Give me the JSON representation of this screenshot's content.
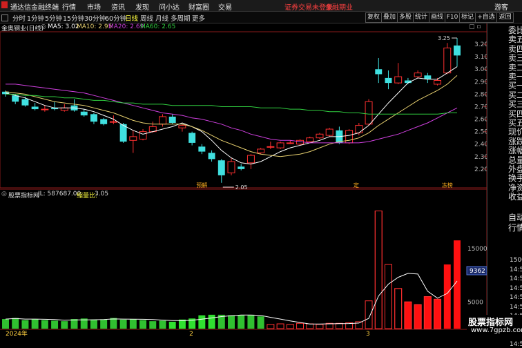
{
  "titlebar": {
    "app_name": "通达信金融终端",
    "menu": [
      "行情",
      "市场",
      "资讯",
      "发现",
      "问小达",
      "财富圈",
      "交易"
    ],
    "notice1": "证券交易未登录",
    "notice2": "金融期业",
    "guest": "游客"
  },
  "toolbar": {
    "periods": [
      "分时",
      "1分钟",
      "5分钟",
      "15分钟",
      "30分钟",
      "60分钟",
      "日线",
      "周线",
      "月线",
      "多周期",
      "更多"
    ],
    "active": "日线",
    "right_buttons": [
      "复权",
      "叠加",
      "多股",
      "统计",
      "画线",
      "F10",
      "标记",
      "+自选",
      "返回"
    ]
  },
  "stock": {
    "name": "金奥钢业(日线)"
  },
  "ma_legend": [
    {
      "label": "MA5: 3.02",
      "color": "#ffffff"
    },
    {
      "label": "MA10: 2.95",
      "color": "#e8d170"
    },
    {
      "label": "MA20: 2.69",
      "color": "#d040e0"
    },
    {
      "label": "MA60: 2.65",
      "color": "#30d040"
    }
  ],
  "indicator_legend": {
    "name": "股票指标网",
    "jl": "JL: 587687.00",
    "ratio_label": "缩量比:",
    "ratio_value": "3.05"
  },
  "price_axis": [
    "3.20",
    "3.10",
    "3.00",
    "2.90",
    "2.80",
    "2.70",
    "2.60",
    "2.50",
    "2.40",
    "2.30",
    "2.20"
  ],
  "annotations": {
    "high": "3.25",
    "low": "2.05"
  },
  "event_markers": [
    "预解",
    "定",
    "冻榜"
  ],
  "time_axis": [
    "2024年",
    "2",
    "3"
  ],
  "right_panel": [
    "委比",
    "卖五",
    "卖四",
    "卖三",
    "卖二",
    "卖一",
    "买一",
    "买二",
    "买三",
    "买四",
    "买五",
    "现价",
    "涨跌",
    "涨幅",
    "总量",
    "外盘",
    "换手",
    "净资",
    "收益"
  ],
  "vol_panel": {
    "labels": [
      "自动",
      "行情"
    ],
    "ticks": [
      "15000",
      "14:50",
      "14:50",
      "14:50",
      "14:50",
      "14:50",
      "14:50",
      "5000",
      "14:50",
      "14:50"
    ],
    "box_value": "9362"
  },
  "watermark": {
    "line1": "股票指标网",
    "line2": "www.7gpzb.com"
  },
  "colors": {
    "up": "#ff3030",
    "down": "#40e0e0",
    "vol_down": "#30e030",
    "vol_up_last": "#ff1010"
  },
  "chart_data": {
    "type": "candlestick",
    "candles": [
      {
        "o": 2.82,
        "c": 2.8,
        "h": 2.83,
        "l": 2.78
      },
      {
        "o": 2.79,
        "c": 2.74,
        "h": 2.8,
        "l": 2.72
      },
      {
        "o": 2.76,
        "c": 2.71,
        "h": 2.78,
        "l": 2.7
      },
      {
        "o": 2.7,
        "c": 2.68,
        "h": 2.73,
        "l": 2.67
      },
      {
        "o": 2.68,
        "c": 2.68,
        "h": 2.71,
        "l": 2.66
      },
      {
        "o": 2.69,
        "c": 2.68,
        "h": 2.74,
        "l": 2.67
      },
      {
        "o": 2.67,
        "c": 2.69,
        "h": 2.72,
        "l": 2.66
      },
      {
        "o": 2.71,
        "c": 2.67,
        "h": 2.76,
        "l": 2.66
      },
      {
        "o": 2.66,
        "c": 2.63,
        "h": 2.68,
        "l": 2.62
      },
      {
        "o": 2.64,
        "c": 2.58,
        "h": 2.65,
        "l": 2.56
      },
      {
        "o": 2.6,
        "c": 2.56,
        "h": 2.61,
        "l": 2.55
      },
      {
        "o": 2.58,
        "c": 2.58,
        "h": 2.63,
        "l": 2.56
      },
      {
        "o": 2.56,
        "c": 2.42,
        "h": 2.57,
        "l": 2.41
      },
      {
        "o": 2.43,
        "c": 2.46,
        "h": 2.51,
        "l": 2.33
      },
      {
        "o": 2.44,
        "c": 2.5,
        "h": 2.52,
        "l": 2.43
      },
      {
        "o": 2.5,
        "c": 2.54,
        "h": 2.58,
        "l": 2.49
      },
      {
        "o": 2.56,
        "c": 2.62,
        "h": 2.64,
        "l": 2.54
      },
      {
        "o": 2.62,
        "c": 2.57,
        "h": 2.64,
        "l": 2.56
      },
      {
        "o": 2.53,
        "c": 2.55,
        "h": 2.56,
        "l": 2.5
      },
      {
        "o": 2.49,
        "c": 2.41,
        "h": 2.5,
        "l": 2.39
      },
      {
        "o": 2.38,
        "c": 2.34,
        "h": 2.4,
        "l": 2.32
      },
      {
        "o": 2.33,
        "c": 2.28,
        "h": 2.35,
        "l": 2.26
      },
      {
        "o": 2.27,
        "c": 2.15,
        "h": 2.28,
        "l": 2.09
      },
      {
        "o": 2.17,
        "c": 2.26,
        "h": 2.29,
        "l": 2.15
      },
      {
        "o": 2.22,
        "c": 2.2,
        "h": 2.24,
        "l": 2.19
      },
      {
        "o": 2.25,
        "c": 2.31,
        "h": 2.32,
        "l": 2.2
      },
      {
        "o": 2.33,
        "c": 2.36,
        "h": 2.37,
        "l": 2.32
      },
      {
        "o": 2.38,
        "c": 2.38,
        "h": 2.42,
        "l": 2.36
      },
      {
        "o": 2.37,
        "c": 2.41,
        "h": 2.42,
        "l": 2.36
      },
      {
        "o": 2.41,
        "c": 2.41,
        "h": 2.43,
        "l": 2.4
      },
      {
        "o": 2.4,
        "c": 2.43,
        "h": 2.44,
        "l": 2.39
      },
      {
        "o": 2.42,
        "c": 2.45,
        "h": 2.46,
        "l": 2.41
      },
      {
        "o": 2.45,
        "c": 2.48,
        "h": 2.49,
        "l": 2.44
      },
      {
        "o": 2.47,
        "c": 2.52,
        "h": 2.53,
        "l": 2.46
      },
      {
        "o": 2.51,
        "c": 2.41,
        "h": 2.54,
        "l": 2.4
      },
      {
        "o": 2.41,
        "c": 2.51,
        "h": 2.52,
        "l": 2.4
      },
      {
        "o": 2.49,
        "c": 2.55,
        "h": 2.57,
        "l": 2.47
      },
      {
        "o": 2.56,
        "c": 2.74,
        "h": 2.76,
        "l": 2.55
      },
      {
        "o": 3.0,
        "c": 2.96,
        "h": 3.09,
        "l": 2.89
      },
      {
        "o": 2.93,
        "c": 2.89,
        "h": 2.99,
        "l": 2.84
      },
      {
        "o": 2.89,
        "c": 2.94,
        "h": 3.05,
        "l": 2.88
      },
      {
        "o": 2.91,
        "c": 2.89,
        "h": 2.93,
        "l": 2.88
      },
      {
        "o": 2.94,
        "c": 2.97,
        "h": 2.99,
        "l": 2.93
      },
      {
        "o": 2.95,
        "c": 2.92,
        "h": 2.97,
        "l": 2.89
      },
      {
        "o": 2.88,
        "c": 2.91,
        "h": 2.93,
        "l": 2.87
      },
      {
        "o": 2.97,
        "c": 3.17,
        "h": 3.21,
        "l": 2.96
      },
      {
        "o": 3.19,
        "c": 3.11,
        "h": 3.25,
        "l": 3.02
      }
    ],
    "ma5": [
      2.81,
      2.79,
      2.77,
      2.74,
      2.71,
      2.69,
      2.69,
      2.69,
      2.68,
      2.66,
      2.63,
      2.6,
      2.55,
      2.51,
      2.48,
      2.5,
      2.52,
      2.54,
      2.57,
      2.54,
      2.5,
      2.43,
      2.35,
      2.29,
      2.25,
      2.24,
      2.26,
      2.3,
      2.34,
      2.37,
      2.39,
      2.41,
      2.43,
      2.46,
      2.46,
      2.47,
      2.49,
      2.55,
      2.64,
      2.73,
      2.81,
      2.89,
      2.93,
      2.92,
      2.92,
      2.97,
      3.02
    ],
    "ma10": [
      2.82,
      2.81,
      2.8,
      2.78,
      2.76,
      2.74,
      2.73,
      2.72,
      2.71,
      2.69,
      2.67,
      2.65,
      2.62,
      2.59,
      2.57,
      2.56,
      2.56,
      2.56,
      2.56,
      2.54,
      2.51,
      2.47,
      2.43,
      2.4,
      2.37,
      2.34,
      2.32,
      2.31,
      2.3,
      2.31,
      2.32,
      2.34,
      2.37,
      2.4,
      2.42,
      2.43,
      2.45,
      2.49,
      2.55,
      2.6,
      2.65,
      2.7,
      2.75,
      2.79,
      2.83,
      2.88,
      2.95
    ],
    "ma20": [
      2.88,
      2.88,
      2.87,
      2.86,
      2.85,
      2.84,
      2.83,
      2.82,
      2.81,
      2.79,
      2.77,
      2.75,
      2.73,
      2.71,
      2.69,
      2.67,
      2.65,
      2.64,
      2.63,
      2.61,
      2.6,
      2.58,
      2.56,
      2.53,
      2.51,
      2.48,
      2.46,
      2.44,
      2.43,
      2.43,
      2.42,
      2.41,
      2.41,
      2.41,
      2.41,
      2.41,
      2.41,
      2.42,
      2.44,
      2.46,
      2.48,
      2.51,
      2.54,
      2.57,
      2.61,
      2.65,
      2.69
    ],
    "ma60": [
      2.8,
      2.8,
      2.79,
      2.79,
      2.78,
      2.78,
      2.77,
      2.77,
      2.76,
      2.75,
      2.75,
      2.74,
      2.73,
      2.73,
      2.72,
      2.72,
      2.72,
      2.71,
      2.71,
      2.71,
      2.71,
      2.71,
      2.7,
      2.7,
      2.7,
      2.7,
      2.69,
      2.69,
      2.69,
      2.68,
      2.68,
      2.67,
      2.67,
      2.66,
      2.66,
      2.65,
      2.65,
      2.64,
      2.64,
      2.64,
      2.64,
      2.64,
      2.64,
      2.64,
      2.64,
      2.65,
      2.65
    ],
    "volume": [
      1800,
      2000,
      1600,
      1800,
      1600,
      1500,
      1400,
      1800,
      1900,
      1700,
      1700,
      2000,
      1700,
      1800,
      1600,
      1400,
      1500,
      1300,
      1700,
      1900,
      2500,
      2600,
      2600,
      2500,
      2500,
      2500,
      2300,
      800,
      900,
      800,
      1000,
      900,
      800,
      1000,
      1000,
      1100,
      1300,
      5200,
      22000,
      12000,
      7500,
      5000,
      4500,
      6000,
      5500,
      12000,
      16500
    ],
    "volume_dir": [
      "d",
      "d",
      "d",
      "d",
      "d",
      "d",
      "d",
      "d",
      "d",
      "d",
      "d",
      "d",
      "d",
      "d",
      "d",
      "d",
      "d",
      "d",
      "d",
      "d",
      "d",
      "d",
      "d",
      "d",
      "d",
      "d",
      "d",
      "u",
      "u",
      "u",
      "u",
      "u",
      "u",
      "u",
      "u",
      "u",
      "u",
      "u",
      "u",
      "u",
      "u",
      "u",
      "u",
      "u",
      "u",
      "u",
      "u"
    ],
    "ylim": [
      2.05,
      3.3
    ],
    "y_ticks": [
      3.2,
      3.1,
      3.0,
      2.9,
      2.8,
      2.7,
      2.6,
      2.5,
      2.4,
      2.3,
      2.2
    ]
  }
}
